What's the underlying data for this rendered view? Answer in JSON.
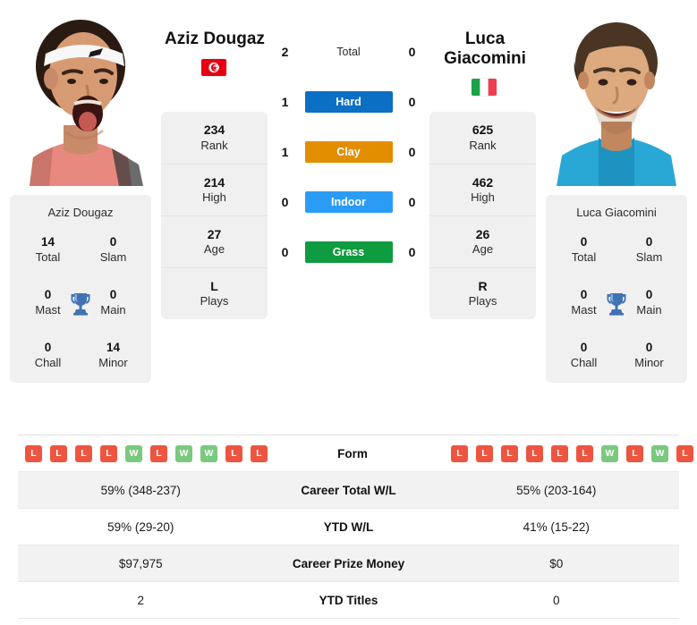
{
  "players": {
    "left": {
      "name": "Aziz Dougaz",
      "card_name": "Aziz Dougaz",
      "flag": "tunisia-flag",
      "titles": [
        {
          "value": "14",
          "label": "Total"
        },
        {
          "value": "0",
          "label": "Slam"
        },
        {
          "value": "0",
          "label": "Mast"
        },
        {
          "value": "0",
          "label": "Main"
        },
        {
          "value": "0",
          "label": "Chall"
        },
        {
          "value": "14",
          "label": "Minor"
        }
      ],
      "profile": [
        {
          "value": "234",
          "label": "Rank"
        },
        {
          "value": "214",
          "label": "High"
        },
        {
          "value": "27",
          "label": "Age"
        },
        {
          "value": "L",
          "label": "Plays"
        }
      ],
      "surface_wins": {
        "total": "2",
        "hard": "1",
        "clay": "1",
        "indoor": "0",
        "grass": "0"
      },
      "form": [
        "L",
        "L",
        "L",
        "L",
        "W",
        "L",
        "W",
        "W",
        "L",
        "L"
      ],
      "career_total_wl": "59% (348-237)",
      "ytd_wl": "59% (29-20)",
      "career_prize_money": "$97,975",
      "ytd_titles": "2"
    },
    "right": {
      "name": "Luca Giacomini",
      "card_name": "Luca Giacomini",
      "flag": "italy-flag",
      "titles": [
        {
          "value": "0",
          "label": "Total"
        },
        {
          "value": "0",
          "label": "Slam"
        },
        {
          "value": "0",
          "label": "Mast"
        },
        {
          "value": "0",
          "label": "Main"
        },
        {
          "value": "0",
          "label": "Chall"
        },
        {
          "value": "0",
          "label": "Minor"
        }
      ],
      "profile": [
        {
          "value": "625",
          "label": "Rank"
        },
        {
          "value": "462",
          "label": "High"
        },
        {
          "value": "26",
          "label": "Age"
        },
        {
          "value": "R",
          "label": "Plays"
        }
      ],
      "surface_wins": {
        "total": "0",
        "hard": "0",
        "clay": "0",
        "indoor": "0",
        "grass": "0"
      },
      "form": [
        "L",
        "L",
        "L",
        "L",
        "L",
        "L",
        "W",
        "L",
        "W",
        "L"
      ],
      "career_total_wl": "55% (203-164)",
      "ytd_wl": "41% (15-22)",
      "career_prize_money": "$0",
      "ytd_titles": "0"
    }
  },
  "surfaces": [
    {
      "key": "total",
      "label": "Total",
      "color": "transparent",
      "plain": true
    },
    {
      "key": "hard",
      "label": "Hard",
      "color": "#0b6fc4",
      "plain": false
    },
    {
      "key": "clay",
      "label": "Clay",
      "color": "#e28e00",
      "plain": false
    },
    {
      "key": "indoor",
      "label": "Indoor",
      "color": "#2b9cf5",
      "plain": false
    },
    {
      "key": "grass",
      "label": "Grass",
      "color": "#0f9b3f",
      "plain": false
    }
  ],
  "table_rows": [
    {
      "label": "Form",
      "key": "form"
    },
    {
      "label": "Career Total W/L",
      "key": "career_total_wl"
    },
    {
      "label": "YTD W/L",
      "key": "ytd_wl"
    },
    {
      "label": "Career Prize Money",
      "key": "career_prize_money"
    },
    {
      "label": "YTD Titles",
      "key": "ytd_titles"
    }
  ],
  "colors": {
    "win": "#7ac97f",
    "loss": "#ee5540",
    "card_bg": "#f0f0f0",
    "row_alt": "#f2f2f2"
  }
}
